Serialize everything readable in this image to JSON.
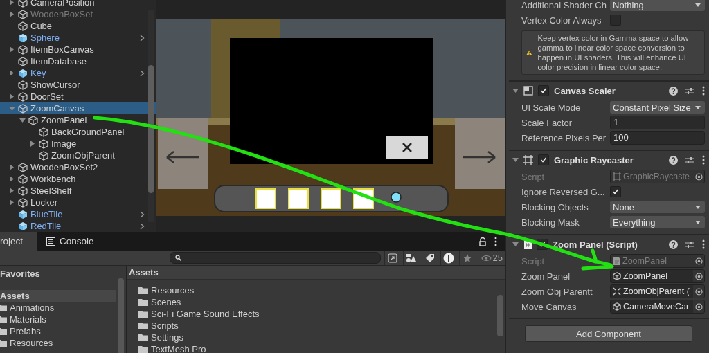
{
  "hierarchy": {
    "items": [
      {
        "name": "CameraPosition",
        "kind": "object",
        "disabled": false,
        "selected": false,
        "expanded": false
      },
      {
        "name": "WoodenBoxSet",
        "kind": "object",
        "disabled": true,
        "selected": false,
        "expanded": false
      },
      {
        "name": "Cube",
        "kind": "object",
        "disabled": false,
        "selected": false
      },
      {
        "name": "Sphere",
        "kind": "prefab",
        "disabled": false,
        "selected": false
      },
      {
        "name": "ItemBoxCanvas",
        "kind": "object",
        "disabled": false,
        "selected": false,
        "expanded": false
      },
      {
        "name": "ItemDatabase",
        "kind": "object",
        "disabled": false,
        "selected": false
      },
      {
        "name": "Key",
        "kind": "prefab",
        "disabled": false,
        "selected": false,
        "expanded": false
      },
      {
        "name": "ShowCursor",
        "kind": "object",
        "disabled": false,
        "selected": false
      },
      {
        "name": "DoorSet",
        "kind": "object",
        "disabled": false,
        "selected": false,
        "expanded": false
      },
      {
        "name": "ZoomCanvas",
        "kind": "object",
        "disabled": false,
        "selected": true,
        "expanded": true,
        "children": [
          {
            "name": "ZoomPanel",
            "kind": "object",
            "disabled": false,
            "selected": false,
            "expanded": true,
            "children": [
              {
                "name": "BackGroundPanel",
                "kind": "object",
                "disabled": false,
                "selected": false
              },
              {
                "name": "Image",
                "kind": "object",
                "disabled": false,
                "selected": false,
                "expanded": false
              },
              {
                "name": "ZoomObjParent",
                "kind": "object",
                "disabled": false,
                "selected": false
              }
            ]
          }
        ]
      },
      {
        "name": "WoodenBoxSet2",
        "kind": "object",
        "disabled": false,
        "selected": false,
        "expanded": false
      },
      {
        "name": "Workbench",
        "kind": "object",
        "disabled": false,
        "selected": false,
        "expanded": false
      },
      {
        "name": "SteelShelf",
        "kind": "object",
        "disabled": false,
        "selected": false,
        "expanded": false
      },
      {
        "name": "Locker",
        "kind": "object",
        "disabled": false,
        "selected": false,
        "expanded": false
      },
      {
        "name": "BlueTile",
        "kind": "prefab",
        "disabled": false,
        "selected": false
      },
      {
        "name": "RedTile",
        "kind": "prefab",
        "disabled": false,
        "selected": false
      }
    ]
  },
  "inspector": {
    "fields": [
      {
        "label": "Additional Shader Ch",
        "kind": "dropdown",
        "value": "Nothing"
      },
      {
        "label": "Vertex Color Always",
        "kind": "checkbox",
        "checked": false
      }
    ],
    "help_box": {
      "text": "Keep vertex color in Gamma space to allow gamma to linear color space conversion to happen in UI shaders. This will enhance UI color precision in linear color space."
    },
    "components": [
      {
        "title": "Canvas Scaler",
        "kind": "scaler",
        "enabled": true,
        "fields": [
          {
            "label": "UI Scale Mode",
            "kind": "dropdown",
            "value": "Constant Pixel Size"
          },
          {
            "label": "Scale Factor",
            "kind": "text",
            "value": "1"
          },
          {
            "label": "Reference Pixels Per",
            "kind": "text",
            "value": "100"
          }
        ]
      },
      {
        "title": "Graphic Raycaster",
        "kind": "raycaster",
        "enabled": true,
        "fields": [
          {
            "label": "Script",
            "kind": "object",
            "value": "GraphicRaycaste",
            "disabled": true
          },
          {
            "label": "Ignore Reversed G...",
            "kind": "checkbox",
            "checked": true
          },
          {
            "label": "Blocking Objects",
            "kind": "dropdown",
            "value": "None"
          },
          {
            "label": "Blocking Mask",
            "kind": "dropdown",
            "value": "Everything"
          }
        ]
      },
      {
        "title": "Zoom Panel (Script)",
        "kind": "script",
        "enabled": true,
        "fields": [
          {
            "label": "Script",
            "kind": "object",
            "value": "ZoomPanel",
            "disabled": true
          },
          {
            "label": "Zoom Panel",
            "kind": "object",
            "value": "ZoomPanel",
            "disabled": false
          },
          {
            "label": "Zoom Obj Parentt",
            "kind": "object",
            "value": "ZoomObjParent (",
            "disabled": false
          },
          {
            "label": "Move Canvas",
            "kind": "object",
            "value": "CameraMoveCar",
            "disabled": false
          }
        ]
      }
    ],
    "add_component_button": "Add Component"
  },
  "project": {
    "tabs": [
      {
        "label": "roject",
        "selected": true,
        "icon": false
      },
      {
        "label": "Console",
        "selected": false,
        "icon": true
      }
    ],
    "hidden_count": "25",
    "favorites": "Favorites",
    "tree": [
      {
        "name": "Assets",
        "selected": true,
        "children": [
          {
            "name": "Animations",
            "selected": false
          },
          {
            "name": "Materials",
            "selected": false
          },
          {
            "name": "Prefabs",
            "selected": false
          },
          {
            "name": "Resources",
            "selected": false
          }
        ]
      }
    ],
    "breadcrumb": "Assets",
    "files": [
      "Resources",
      "Scenes",
      "Sci-Fi Game Sound Effects",
      "Scripts",
      "Settings",
      "TextMesh Pro"
    ]
  }
}
